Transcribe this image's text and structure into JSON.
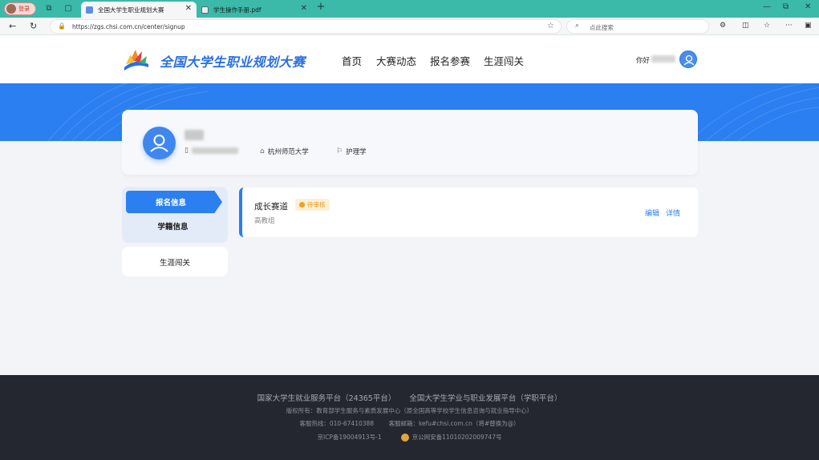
{
  "browser": {
    "profile_label": "登录",
    "tabs": [
      {
        "title": "全国大学生职业规划大赛",
        "active": true
      },
      {
        "title": "学生操作手册.pdf",
        "active": false
      }
    ],
    "url": "https://zgs.chsi.com.cn/center/signup",
    "search_placeholder": "点此搜索"
  },
  "site": {
    "logo_text": "全国大学生职业规划大赛",
    "nav": [
      "首页",
      "大赛动态",
      "报名参赛",
      "生涯闯关"
    ],
    "greeting": "你好"
  },
  "profile": {
    "school": "杭州师范大学",
    "major": "护理学"
  },
  "menu": {
    "active": "报名信息",
    "sub": "学籍信息",
    "single": "生涯闯关"
  },
  "entry": {
    "title": "成长赛道",
    "status": "待审核",
    "group": "高教组",
    "edit": "编辑",
    "detail": "详情"
  },
  "footer": {
    "line1": "国家大学生就业服务平台（24365平台） 全国大学生学业与职业发展平台（学职平台）",
    "line2": "版权所有：教育部学生服务与素质发展中心（原全国高等学校学生信息咨询与就业指导中心）",
    "line3": "客服热线：010-67410388 客服邮箱：kefu#chsi.com.cn（将#替换为@）",
    "icp": "京ICP备19004913号-1",
    "police": "京公网安备11010202009747号"
  },
  "colors": {
    "accent": "#2b7ff0",
    "tabbar": "#3bb9a9",
    "footer": "#24272f",
    "pending": "#f0a11c"
  }
}
